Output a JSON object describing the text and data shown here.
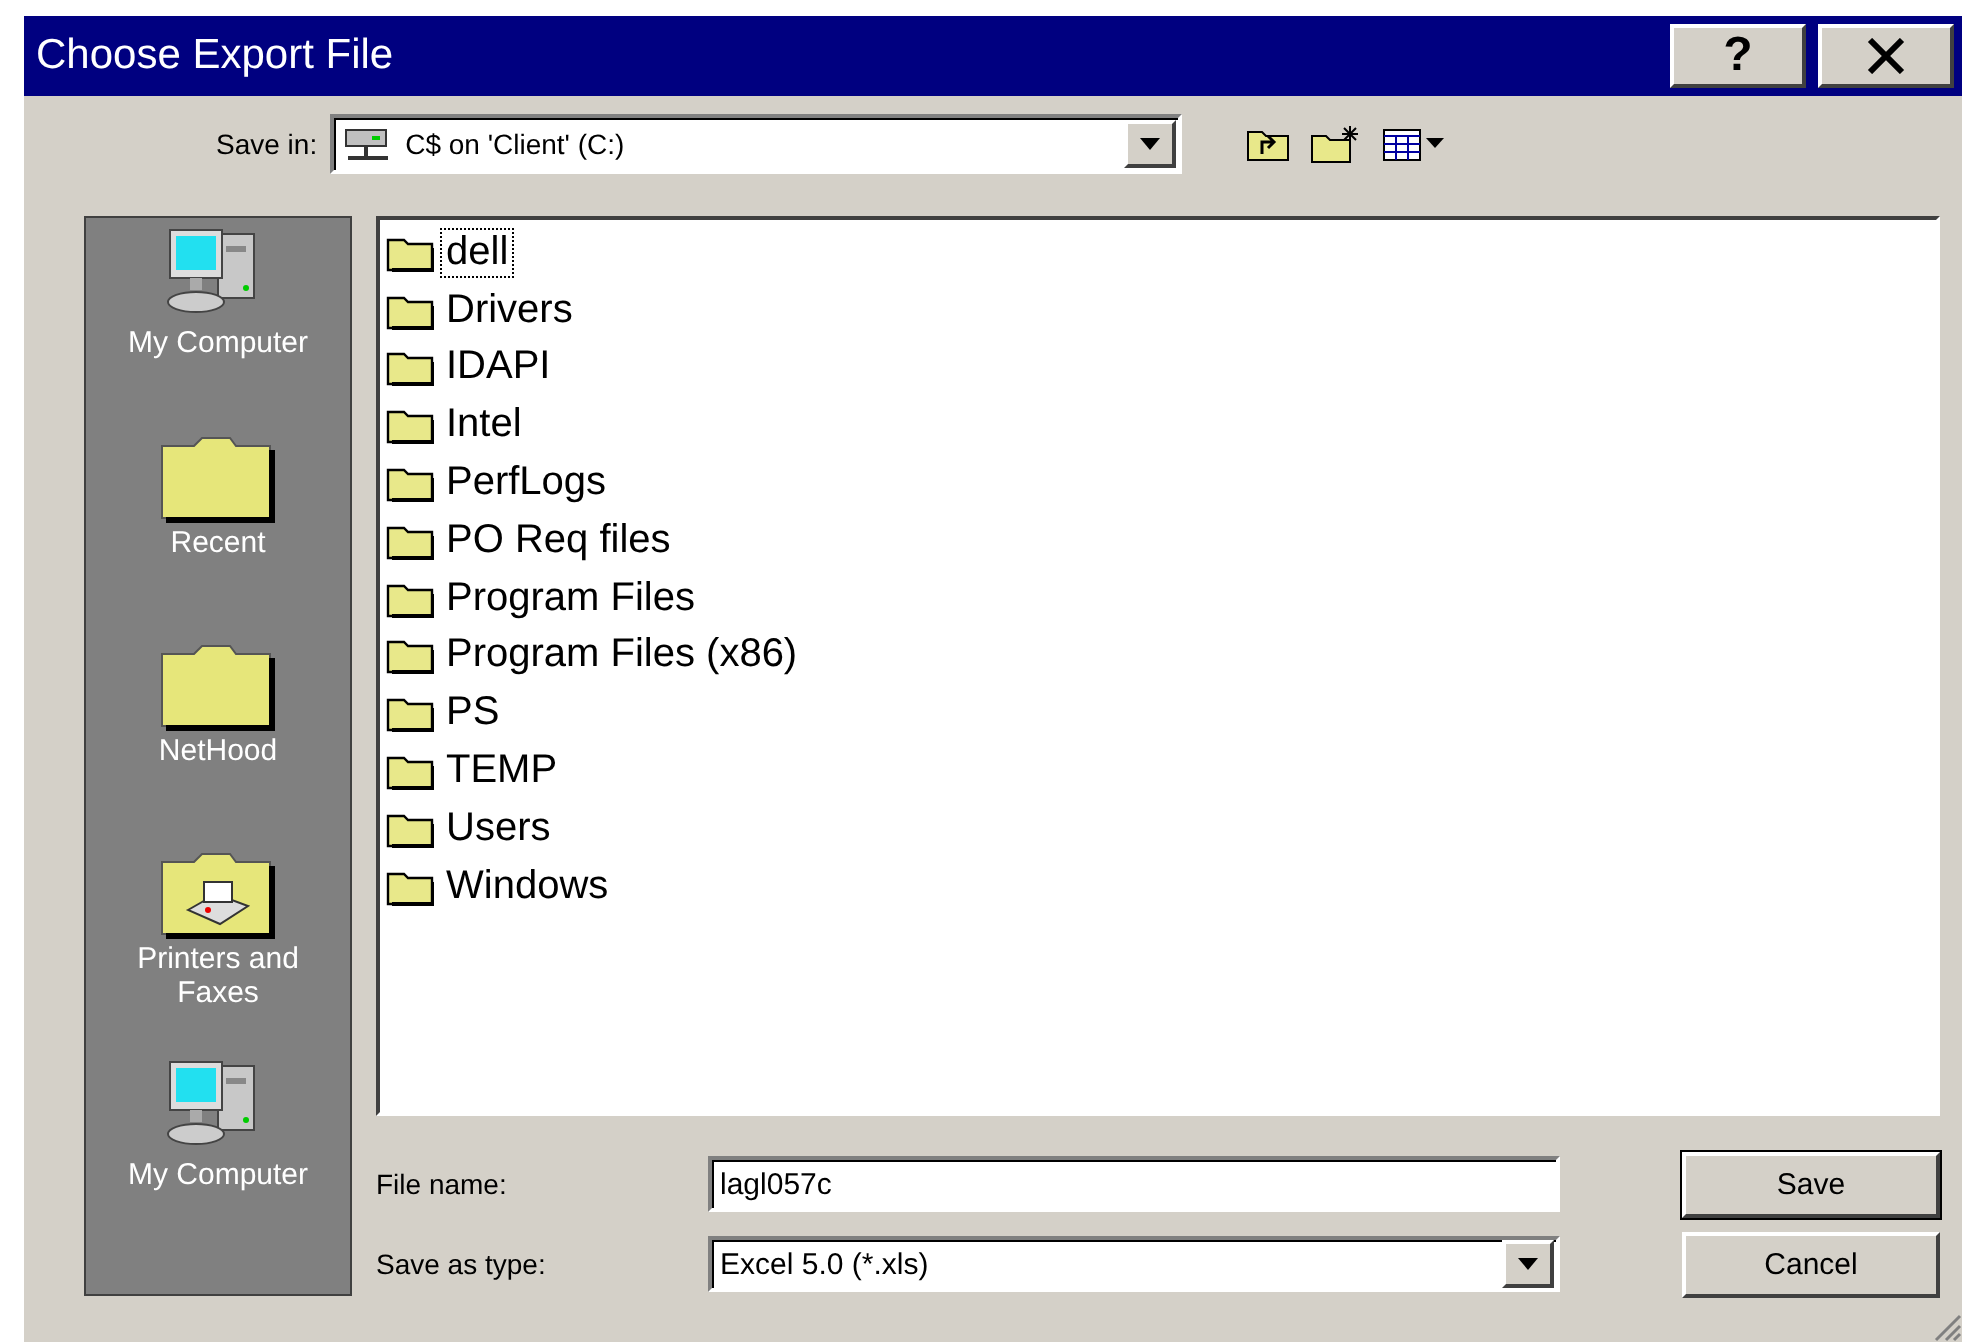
{
  "window": {
    "title": "Choose Export File",
    "help_button": "?"
  },
  "save_in": {
    "label": "Save in:",
    "value": "C$ on 'Client' (C:)"
  },
  "places": [
    {
      "label": "My Computer",
      "kind": "computer"
    },
    {
      "label": "Recent",
      "kind": "folder"
    },
    {
      "label": "NetHood",
      "kind": "folder"
    },
    {
      "label": "Printers and Faxes",
      "kind": "printers"
    },
    {
      "label": "My Computer",
      "kind": "computer"
    }
  ],
  "files": [
    {
      "name": "dell",
      "focused": true
    },
    {
      "name": "Drivers",
      "focused": false
    },
    {
      "name": "IDAPI",
      "focused": false
    },
    {
      "name": "Intel",
      "focused": false
    },
    {
      "name": "PerfLogs",
      "focused": false
    },
    {
      "name": "PO Req files",
      "focused": false
    },
    {
      "name": "Program Files",
      "focused": false
    },
    {
      "name": "Program Files (x86)",
      "focused": false
    },
    {
      "name": "PS",
      "focused": false
    },
    {
      "name": "TEMP",
      "focused": false
    },
    {
      "name": "Users",
      "focused": false
    },
    {
      "name": "Windows",
      "focused": false
    }
  ],
  "file_name": {
    "label": "File name:",
    "value": "lagl057c"
  },
  "save_as_type": {
    "label": "Save as type:",
    "value": "Excel 5.0 (*.xls)"
  },
  "buttons": [
    {
      "label": "Save",
      "default": true
    },
    {
      "label": "Cancel",
      "default": false
    }
  ]
}
